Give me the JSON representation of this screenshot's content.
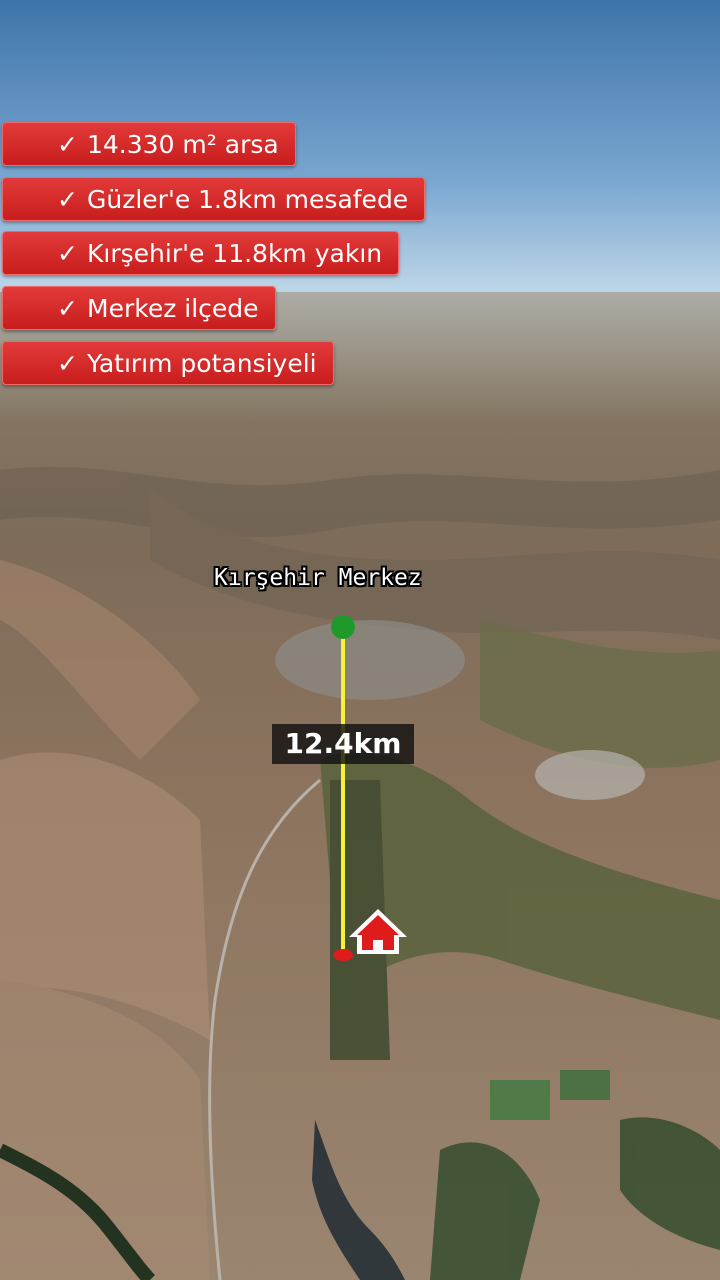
{
  "features": [
    {
      "text": "14.330 m² arsa"
    },
    {
      "text": "Güzler'e 1.8km mesafede"
    },
    {
      "text": "Kırşehir'e 11.8km yakın"
    },
    {
      "text": "Merkez ilçede"
    },
    {
      "text": "Yatırım potansiyeli"
    }
  ],
  "check_symbol": "✓",
  "map": {
    "city_label": "Kırşehir Merkez",
    "distance_label": "12.4km",
    "start_marker_icon": "green-dot-icon",
    "end_marker_icon": "house-icon",
    "line_color": "#f5f23a",
    "start_marker_color": "#1f9a2a",
    "end_marker_color": "#e01b1b"
  }
}
